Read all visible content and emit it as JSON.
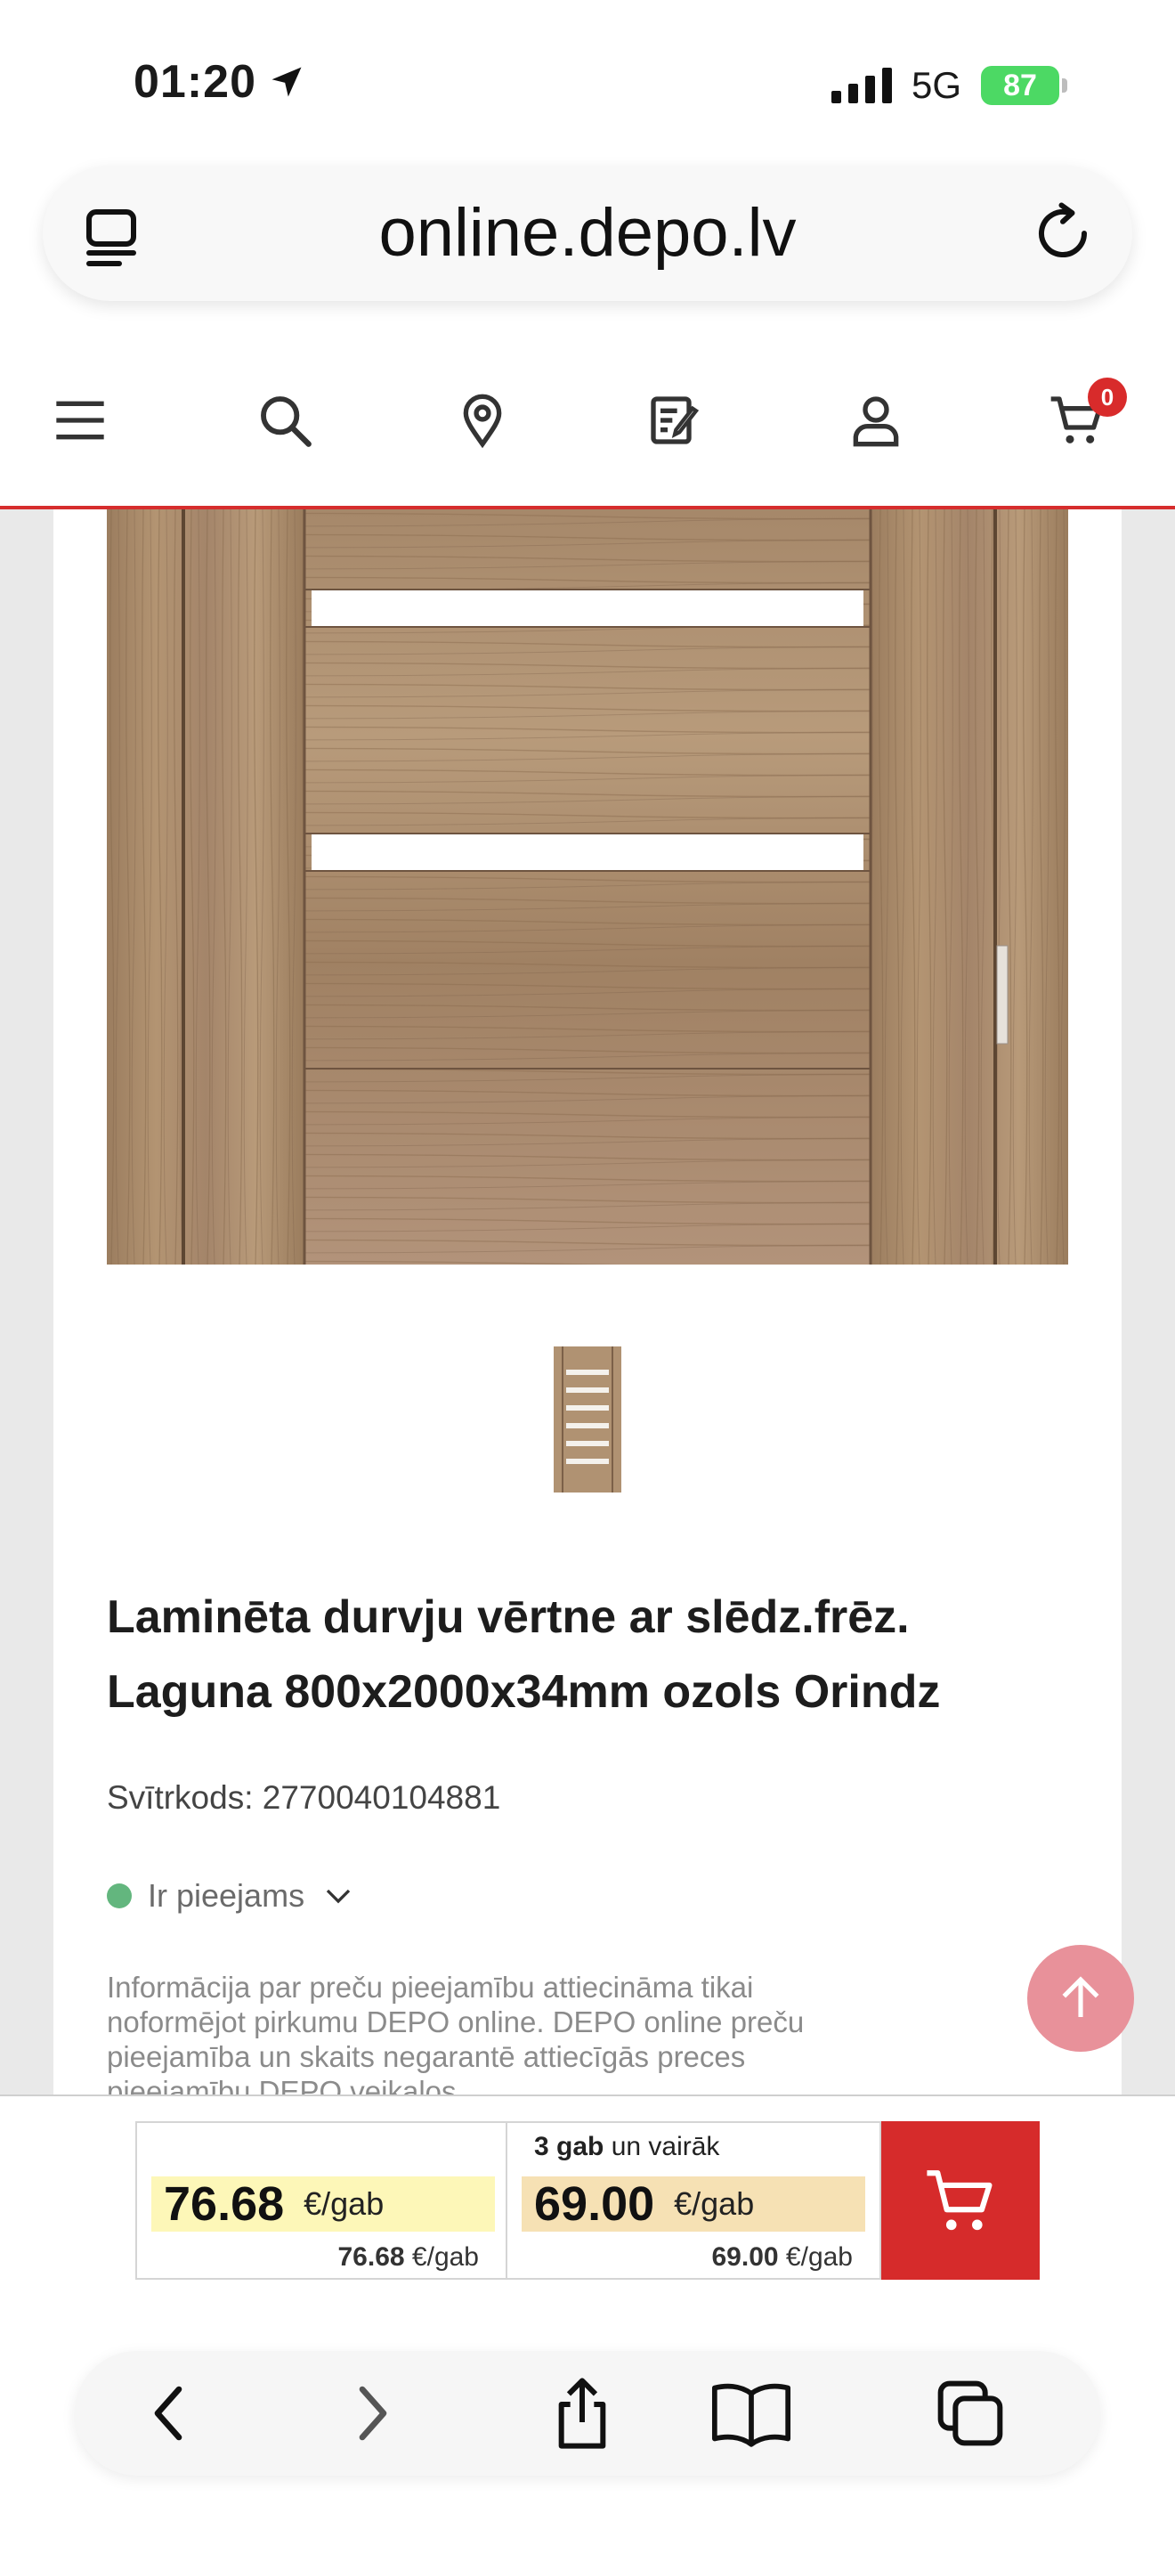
{
  "status_bar": {
    "time": "01:20",
    "network": "5G",
    "battery": "87"
  },
  "browser": {
    "url": "online.depo.lv"
  },
  "site_nav": {
    "cart_count": "0"
  },
  "product": {
    "title": "Laminēta durvju vērtne ar slēdz.frēz. Laguna 800x2000x34mm ozols Orindz",
    "barcode": "Svītrkods: 2770040104881",
    "availability": "Ir pieejams",
    "info": "Informācija par preču pieejamību attiecināma tikai noformējot pirkumu DEPO online. DEPO online preču pieejamība  un skaits negarantē attiecīgās preces pieejamību DEPO veikalos."
  },
  "pricing": {
    "single": {
      "price": "76.68",
      "unit": "€/gab",
      "small_price": "76.68",
      "small_unit": "€/gab"
    },
    "bulk": {
      "qty_bold": "3 gab",
      "qty_rest": "un vairāk",
      "price": "69.00",
      "unit": "€/gab",
      "small_price": "69.00",
      "small_unit": "€/gab"
    }
  },
  "colors": {
    "accent": "#d62b2b",
    "price_highlight_1": "#fdf7b8",
    "price_highlight_2": "#f6e1b4",
    "available": "#63b67e",
    "scroll_top": "#e8919a"
  },
  "icons": [
    "location-arrow-icon",
    "signal-icon",
    "tabs-icon",
    "reload-icon",
    "menu-icon",
    "search-icon",
    "map-pin-icon",
    "edit-list-icon",
    "user-icon",
    "cart-icon",
    "chevron-down-icon",
    "arrow-up-icon",
    "back-icon",
    "forward-icon",
    "share-icon",
    "bookmarks-icon",
    "tabs-overview-icon"
  ]
}
